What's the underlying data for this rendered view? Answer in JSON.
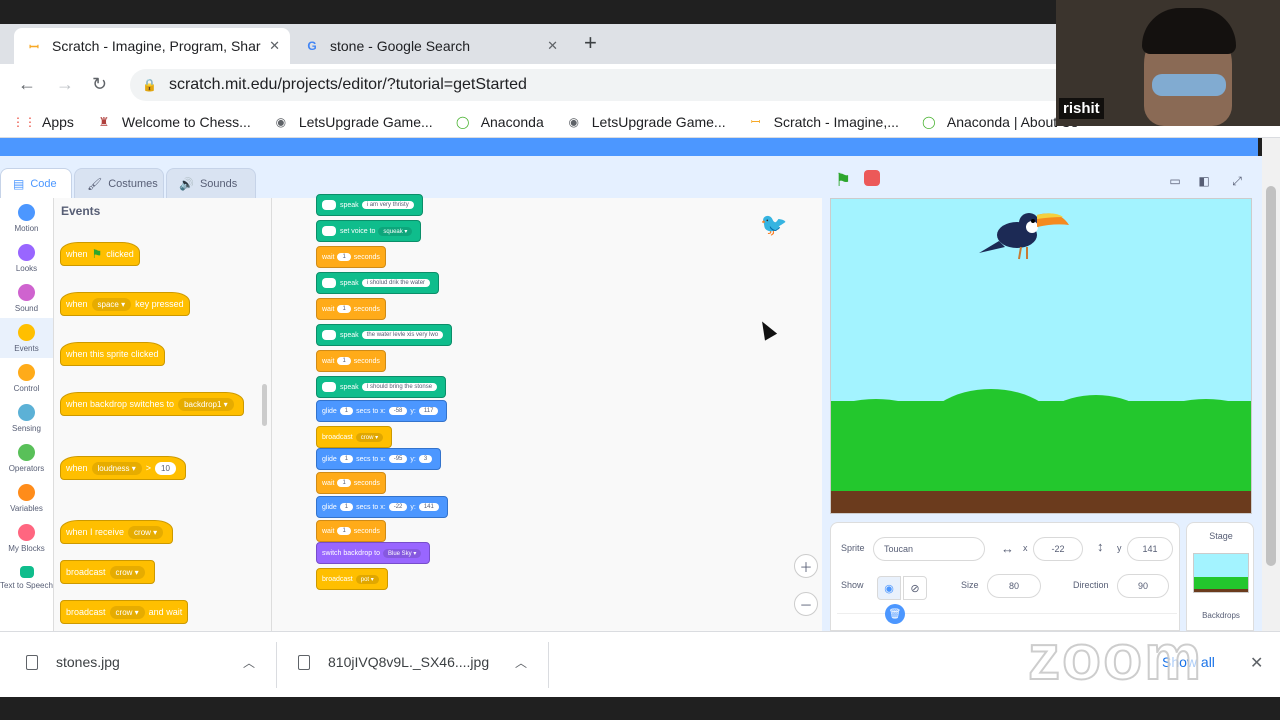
{
  "browser": {
    "tabs": [
      {
        "title": "Scratch - Imagine, Program, Shar",
        "favicon": "scratch-icon",
        "active": true
      },
      {
        "title": "stone - Google Search",
        "favicon": "google-icon",
        "active": false
      }
    ],
    "url": "scratch.mit.edu/projects/editor/?tutorial=getStarted",
    "bookmarks": [
      {
        "label": "Apps",
        "icon": "apps-grid-icon"
      },
      {
        "label": "Welcome to Chess...",
        "icon": "chess-icon"
      },
      {
        "label": "LetsUpgrade Game...",
        "icon": "globe-icon"
      },
      {
        "label": "Anaconda",
        "icon": "anaconda-icon"
      },
      {
        "label": "LetsUpgrade Game...",
        "icon": "globe-icon"
      },
      {
        "label": "Scratch - Imagine,...",
        "icon": "scratch-icon"
      },
      {
        "label": "Anaconda | About Us",
        "icon": "anaconda-icon"
      }
    ]
  },
  "editor_tabs": [
    {
      "label": "Code",
      "icon": "code-icon",
      "active": true
    },
    {
      "label": "Costumes",
      "icon": "brush-icon",
      "active": false
    },
    {
      "label": "Sounds",
      "icon": "speaker-icon",
      "active": false
    }
  ],
  "categories": [
    {
      "label": "Motion",
      "color": "#4c97ff"
    },
    {
      "label": "Looks",
      "color": "#9966ff"
    },
    {
      "label": "Sound",
      "color": "#cf63cf"
    },
    {
      "label": "Events",
      "color": "#ffbf00",
      "selected": true
    },
    {
      "label": "Control",
      "color": "#ffab19"
    },
    {
      "label": "Sensing",
      "color": "#5cb1d6"
    },
    {
      "label": "Operators",
      "color": "#59c059"
    },
    {
      "label": "Variables",
      "color": "#ff8c1a"
    },
    {
      "label": "My Blocks",
      "color": "#ff6680"
    },
    {
      "label": "Text to Speech",
      "color": "#0fbd8c"
    }
  ],
  "palette": {
    "title": "Events",
    "blocks": [
      {
        "pre": "when",
        "mid": "",
        "post": "clicked",
        "kind": "flag"
      },
      {
        "pre": "when",
        "mid": "space ▾",
        "post": "key pressed",
        "kind": "dd"
      },
      {
        "pre": "when this sprite clicked",
        "mid": "",
        "post": "",
        "kind": "plain"
      },
      {
        "pre": "when backdrop switches to",
        "mid": "backdrop1 ▾",
        "post": "",
        "kind": "dd"
      },
      {
        "pre": "when",
        "mid": "loudness ▾",
        "post": ">",
        "extra": "10",
        "kind": "dd"
      },
      {
        "pre": "when I receive",
        "mid": "crow ▾",
        "post": "",
        "kind": "dd"
      },
      {
        "pre": "broadcast",
        "mid": "crow ▾",
        "post": "",
        "kind": "dd"
      },
      {
        "pre": "broadcast",
        "mid": "crow ▾",
        "post": "and wait",
        "kind": "dd"
      }
    ]
  },
  "script": [
    {
      "type": "speak",
      "label": "speak",
      "arg": "i am very thristy"
    },
    {
      "type": "speak",
      "label": "set voice to",
      "arg": "squeak ▾"
    },
    {
      "type": "ctrl",
      "label": "wait",
      "num": "1",
      "post": "seconds"
    },
    {
      "type": "speak",
      "label": "speak",
      "arg": "i sholud drik the water"
    },
    {
      "type": "ctrl",
      "label": "wait",
      "num": "1",
      "post": "seconds"
    },
    {
      "type": "speak",
      "label": "speak",
      "arg": "the water levle xis very lwo"
    },
    {
      "type": "ctrl",
      "label": "wait",
      "num": "1",
      "post": "seconds"
    },
    {
      "type": "speak",
      "label": "speak",
      "arg": "I should bring the stonse"
    },
    {
      "type": "motion",
      "label": "glide",
      "num": "1",
      "post": "secs to x:",
      "x": "-58",
      "y": "117"
    },
    {
      "type": "event",
      "label": "broadcast",
      "arg": "crow ▾"
    },
    {
      "type": "motion",
      "label": "glide",
      "num": "1",
      "post": "secs to x:",
      "x": "-95",
      "y": "3"
    },
    {
      "type": "ctrl",
      "label": "wait",
      "num": "1",
      "post": "seconds"
    },
    {
      "type": "motion",
      "label": "glide",
      "num": "1",
      "post": "secs to x:",
      "x": "-22",
      "y": "141"
    },
    {
      "type": "ctrl",
      "label": "wait",
      "num": "1",
      "post": "seconds"
    },
    {
      "type": "looks",
      "label": "switch backdrop to",
      "arg": "Blue Sky ▾"
    },
    {
      "type": "event",
      "label": "broadcast",
      "arg": "pot ▾"
    }
  ],
  "sprite_info": {
    "sprite_label": "Sprite",
    "sprite_name": "Toucan",
    "x_label": "x",
    "x": "-22",
    "y_label": "y",
    "y": "141",
    "show_label": "Show",
    "size_label": "Size",
    "size": "80",
    "direction_label": "Direction",
    "direction": "90"
  },
  "stage_pane": {
    "title": "Stage",
    "backdrops_label": "Backdrops"
  },
  "downloads": [
    {
      "name": "stones.jpg"
    },
    {
      "name": "810jIVQ8v9L._SX46....jpg"
    }
  ],
  "show_all": "Show all",
  "webcam": {
    "name": "rishit"
  },
  "zoom_watermark": "zoom",
  "colors": {
    "scratch_blue": "#4c97ff",
    "events_yellow": "#ffbf00",
    "speech_green": "#0fbd8c"
  }
}
